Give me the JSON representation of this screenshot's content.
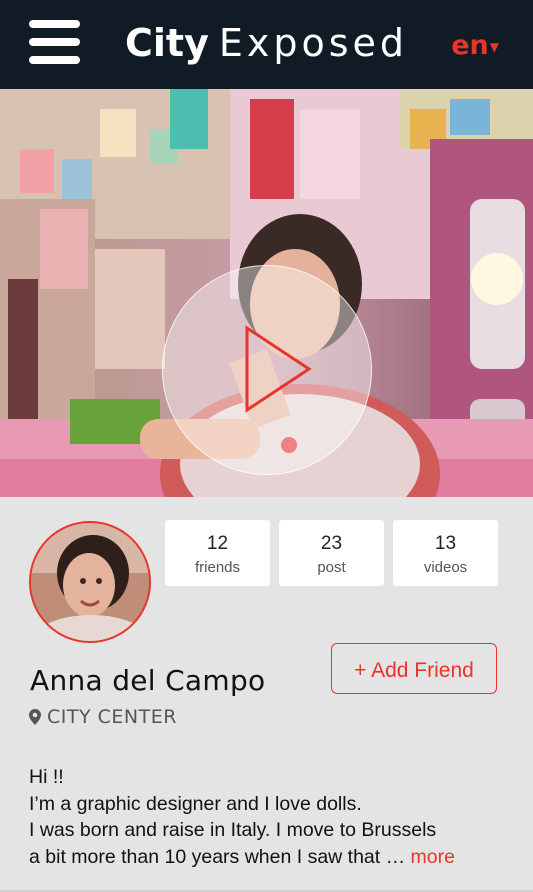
{
  "app": {
    "logo_bold": "City",
    "logo_light": "Exposed",
    "language": "en",
    "colors": {
      "header_bg": "#101b25",
      "accent": "#e8342a",
      "page_bg": "#e4e4e4"
    }
  },
  "header": {
    "menu_icon": "hamburger-menu-icon",
    "language_caret_icon": "caret-down-icon"
  },
  "hero": {
    "play_icon": "play-icon"
  },
  "stats": [
    {
      "value": "12",
      "label": "friends"
    },
    {
      "value": "23",
      "label": "post"
    },
    {
      "value": "13",
      "label": "videos"
    }
  ],
  "profile": {
    "name": "Anna del Campo",
    "location": "CITY CENTER",
    "location_icon": "map-pin-icon",
    "add_friend_label": "+ Add Friend"
  },
  "bio": {
    "lines": [
      "Hi !!",
      "I’m a graphic designer and I love dolls.",
      "I was born and raise in Italy. I move to Brussels",
      "a bit more than 10 years when I saw that …"
    ],
    "more_label": "more"
  }
}
